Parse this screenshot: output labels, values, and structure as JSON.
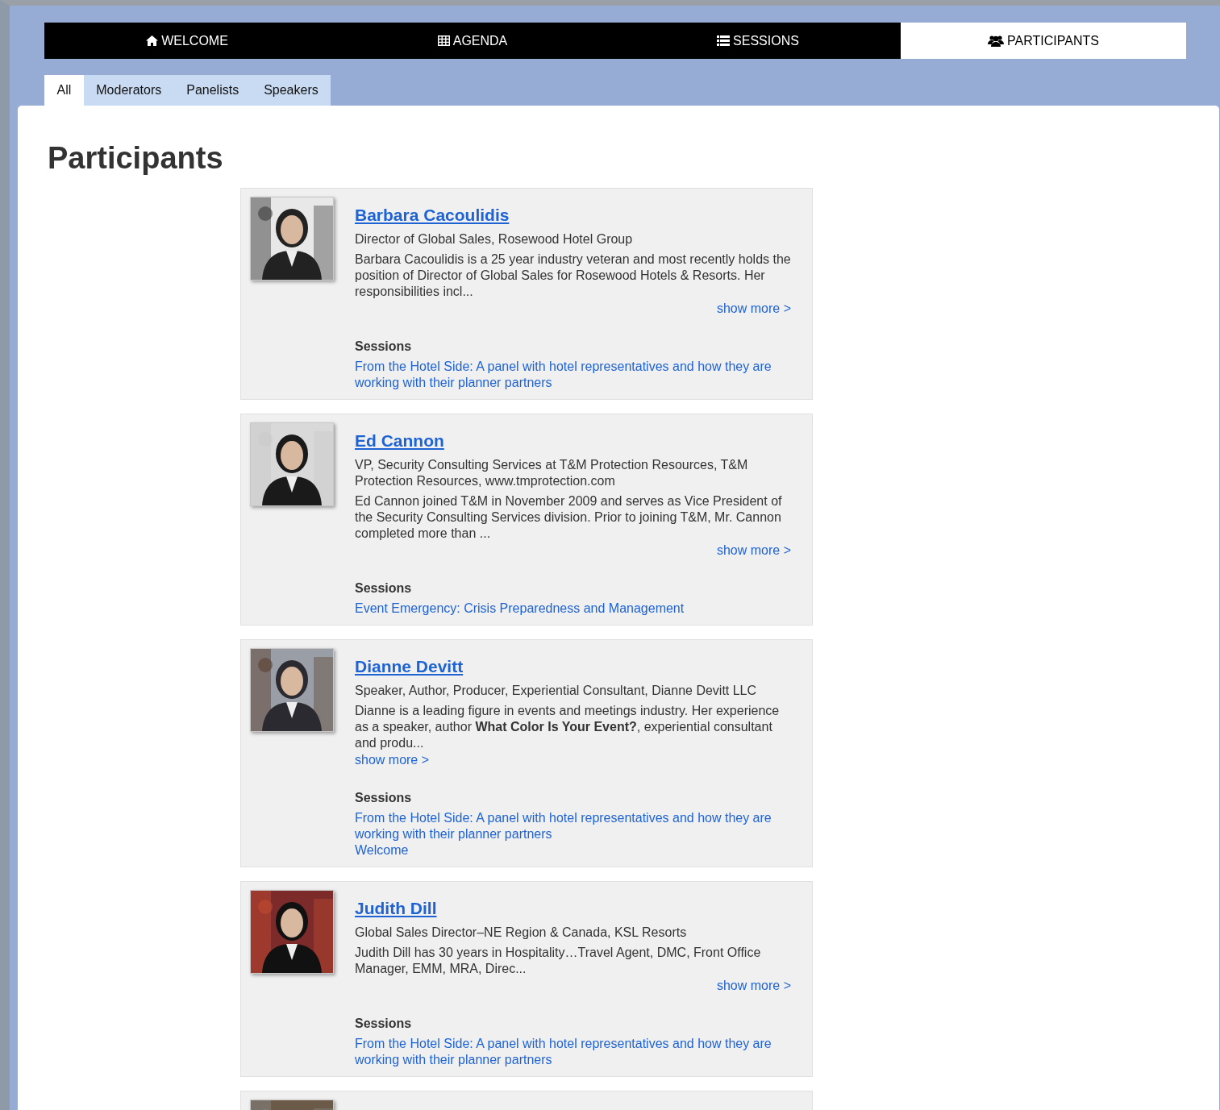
{
  "nav": [
    {
      "label": "WELCOME",
      "selected": false
    },
    {
      "label": "AGENDA",
      "selected": false
    },
    {
      "label": "SESSIONS",
      "selected": false
    },
    {
      "label": "PARTICIPANTS",
      "selected": true
    }
  ],
  "filters": [
    {
      "label": "All",
      "selected": true
    },
    {
      "label": "Moderators",
      "selected": false
    },
    {
      "label": "Panelists",
      "selected": false
    },
    {
      "label": "Speakers",
      "selected": false
    }
  ],
  "heading": "Participants",
  "participants": [
    {
      "kind": "right",
      "name": "Barbara Cacoulidis",
      "title": "Director of Global Sales, Rosewood Hotel Group",
      "bio": "Barbara Cacoulidis is a 25 year industry veteran and most recently holds the position of Director of Global Sales for Rosewood Hotels & Resorts. Her responsibilities incl...",
      "show_more": "show more >",
      "sessions_label": "Sessions",
      "sessions": [
        "From the Hotel Side: A panel with hotel representatives and how they are working with their planner partners"
      ]
    },
    {
      "kind": "right",
      "name": "Ed Cannon",
      "title": "VP, Security Consulting Services at T&M Protection Resources, T&M Protection Resources, www.tmprotection.com",
      "bio": "Ed Cannon joined T&M in November 2009 and serves as Vice President of the Security Consulting Services division. Prior to joining T&M, Mr. Cannon completed more than ...",
      "show_more": "show more >",
      "sessions_label": "Sessions",
      "sessions": [
        "Event Emergency: Crisis Preparedness and Management"
      ]
    },
    {
      "kind": "left",
      "name": "Dianne Devitt",
      "title": "Speaker, Author, Producer, Experiential Consultant, Dianne Devitt LLC",
      "bio": "Dianne is a leading figure in events and meetings industry. Her experience as a speaker, author **What Color Is Your Event?**, experiential consultant and produ...",
      "show_more": "show more >",
      "sessions_label": "Sessions",
      "sessions": [
        "From the Hotel Side: A panel with hotel representatives and how they are working with their planner partners",
        "Welcome"
      ]
    },
    {
      "kind": "right",
      "name": "Judith Dill",
      "title": "Global Sales Director–NE Region & Canada, KSL Resorts",
      "bio": "Judith Dill has 30 years in Hospitality…Travel Agent, DMC, Front Office Manager, EMM, MRA, Direc...",
      "show_more": "show more >",
      "sessions_label": "Sessions",
      "sessions": [
        "From the Hotel Side: A panel with hotel representatives and how they are working with their planner partners"
      ]
    },
    {
      "kind": "cut"
    }
  ]
}
